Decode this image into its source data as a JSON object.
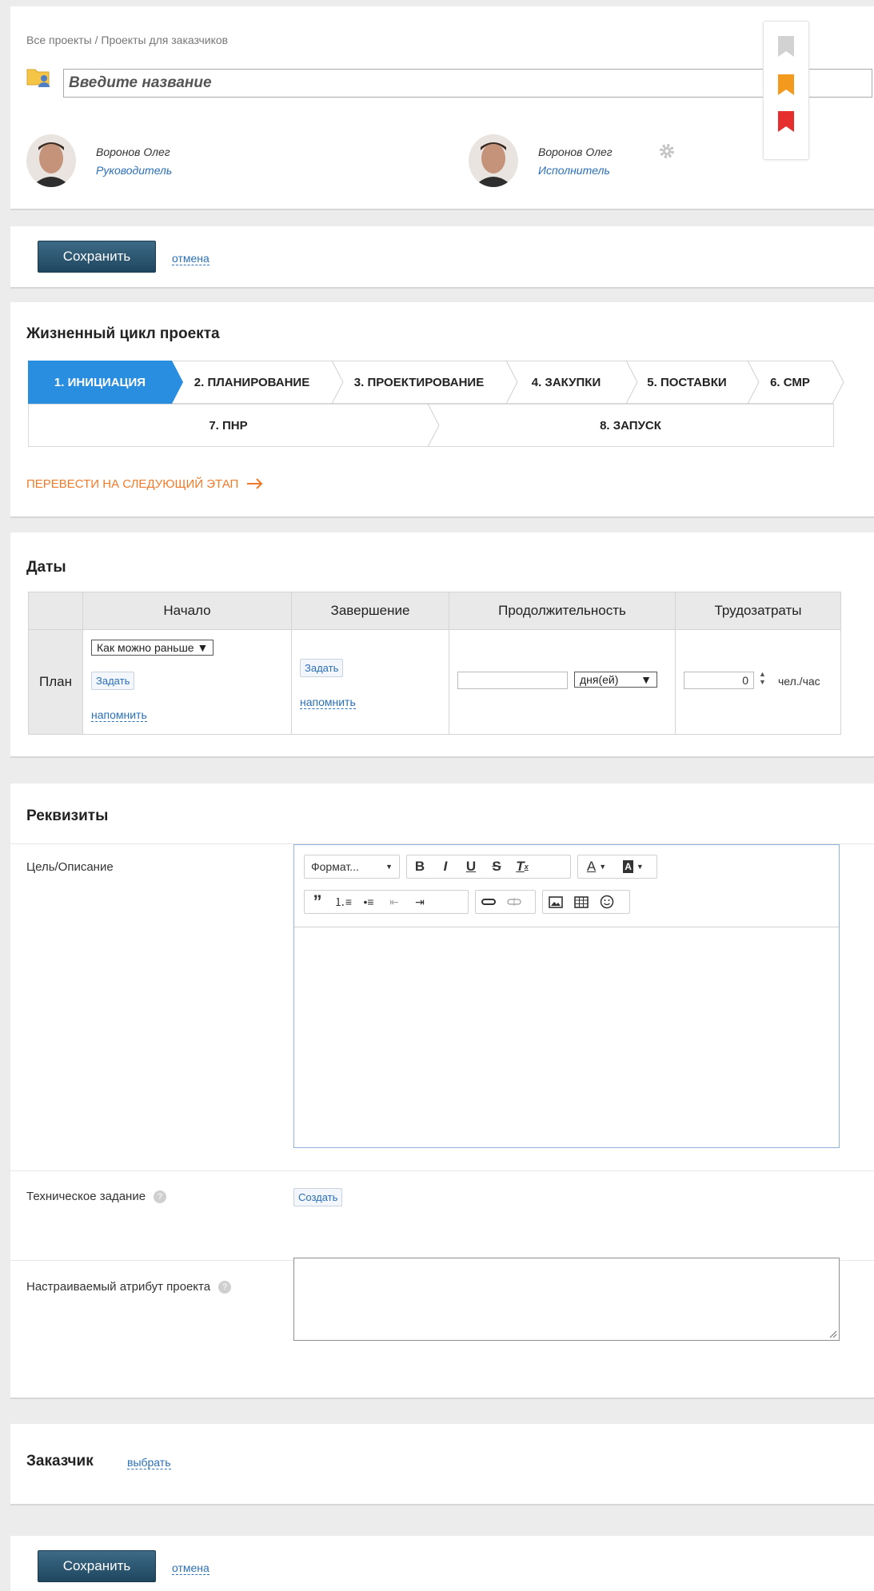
{
  "header": {
    "breadcrumb": "Все проекты / Проекты для заказчиков",
    "title_placeholder": "Введите название",
    "people": [
      {
        "name": "Воронов Олег",
        "role": "Руководитель"
      },
      {
        "name": "Воронов Олег",
        "role": "Исполнитель"
      }
    ],
    "flag_colors": [
      "#d2d2d2",
      "#f39a1e",
      "#e62e2e"
    ]
  },
  "actions": {
    "save_label": "Сохранить",
    "cancel_label": "отмена"
  },
  "lifecycle": {
    "title": "Жизненный цикл проекта",
    "stages": [
      "1. ИНИЦИАЦИЯ",
      "2. ПЛАНИРОВАНИЕ",
      "3. ПРОЕКТИРОВАНИЕ",
      "4. ЗАКУПКИ",
      "5. ПОСТАВКИ",
      "6. СМР",
      "7. ПНР",
      "8. ЗАПУСК"
    ],
    "active_stage": 0,
    "next_stage_label": "ПЕРЕВЕСТИ НА СЛЕДУЮЩИЙ ЭТАП",
    "accent_color": "#2a8ee0",
    "next_color": "#f07a2a"
  },
  "dates": {
    "title": "Даты",
    "columns": [
      "Начало",
      "Завершение",
      "Продолжительность",
      "Трудозатраты"
    ],
    "row_label": "План",
    "start_select": "Как можно раньше ▼",
    "set_label": "Задать",
    "remind_label": "напомнить",
    "duration_unit": "дня(ей)",
    "effort_value": "0",
    "effort_unit": "чел./час"
  },
  "requisites": {
    "title": "Реквизиты",
    "goal_label": "Цель/Описание",
    "format_label": "Формат...",
    "tech_task_label": "Техническое задание",
    "create_label": "Создать",
    "custom_attr_label": "Настраиваемый атрибут проекта"
  },
  "customer": {
    "label": "Заказчик",
    "choose_label": "выбрать"
  }
}
